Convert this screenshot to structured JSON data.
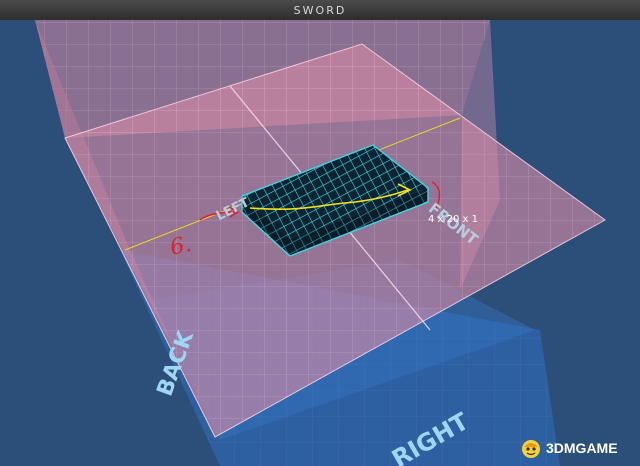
{
  "window": {
    "title": "SWORD"
  },
  "overlay": {
    "line1": "",
    "line2": ""
  },
  "labels": {
    "left": "LEFT",
    "front": "FRONT",
    "back": "BACK",
    "right": "RIGHT"
  },
  "dimensions": "4 x 20 x 1",
  "annotation": {
    "handwritten": "6."
  },
  "watermark": {
    "text": "3DMGAME"
  },
  "colors": {
    "background": "#2c4f79",
    "plane_fill": "#d78aa6",
    "block_fill": "#0e2332",
    "block_grid": "#3fd6e0",
    "label": "#b8cce0",
    "annotation_red": "#e01e2a",
    "annotation_yellow": "#f2e21a"
  }
}
